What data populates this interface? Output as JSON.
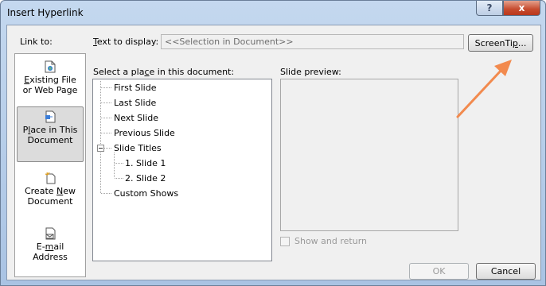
{
  "window": {
    "title": "Insert Hyperlink",
    "help": "?",
    "close": "x"
  },
  "link_to": {
    "label": "Link to:",
    "items": [
      {
        "line1": "Existing File",
        "line2": "or Web Page",
        "icon": "existing-file-icon"
      },
      {
        "line1": "Place in This",
        "line2": "Document",
        "icon": "place-in-document-icon",
        "selected": true
      },
      {
        "line1": "Create New",
        "line2": "Document",
        "icon": "create-new-document-icon"
      },
      {
        "line1": "E-mail",
        "line2": "Address",
        "icon": "email-address-icon"
      }
    ]
  },
  "text_to_display": {
    "label": "Text to display:",
    "value": "<<Selection in Document>>"
  },
  "screentip_button": "ScreenTip...",
  "place_label": "Select a place in this document:",
  "tree": [
    "First Slide",
    "Last Slide",
    "Next Slide",
    "Previous Slide",
    "Slide Titles",
    "1. Slide 1",
    "2. Slide 2",
    "Custom Shows"
  ],
  "preview_label": "Slide preview:",
  "show_and_return": "Show and return",
  "ok_button": "OK",
  "cancel_button": "Cancel",
  "colors": {
    "arrow": "#f28a4e",
    "title_gradient_top": "#c4d8ef",
    "close_red": "#c64a2d"
  }
}
